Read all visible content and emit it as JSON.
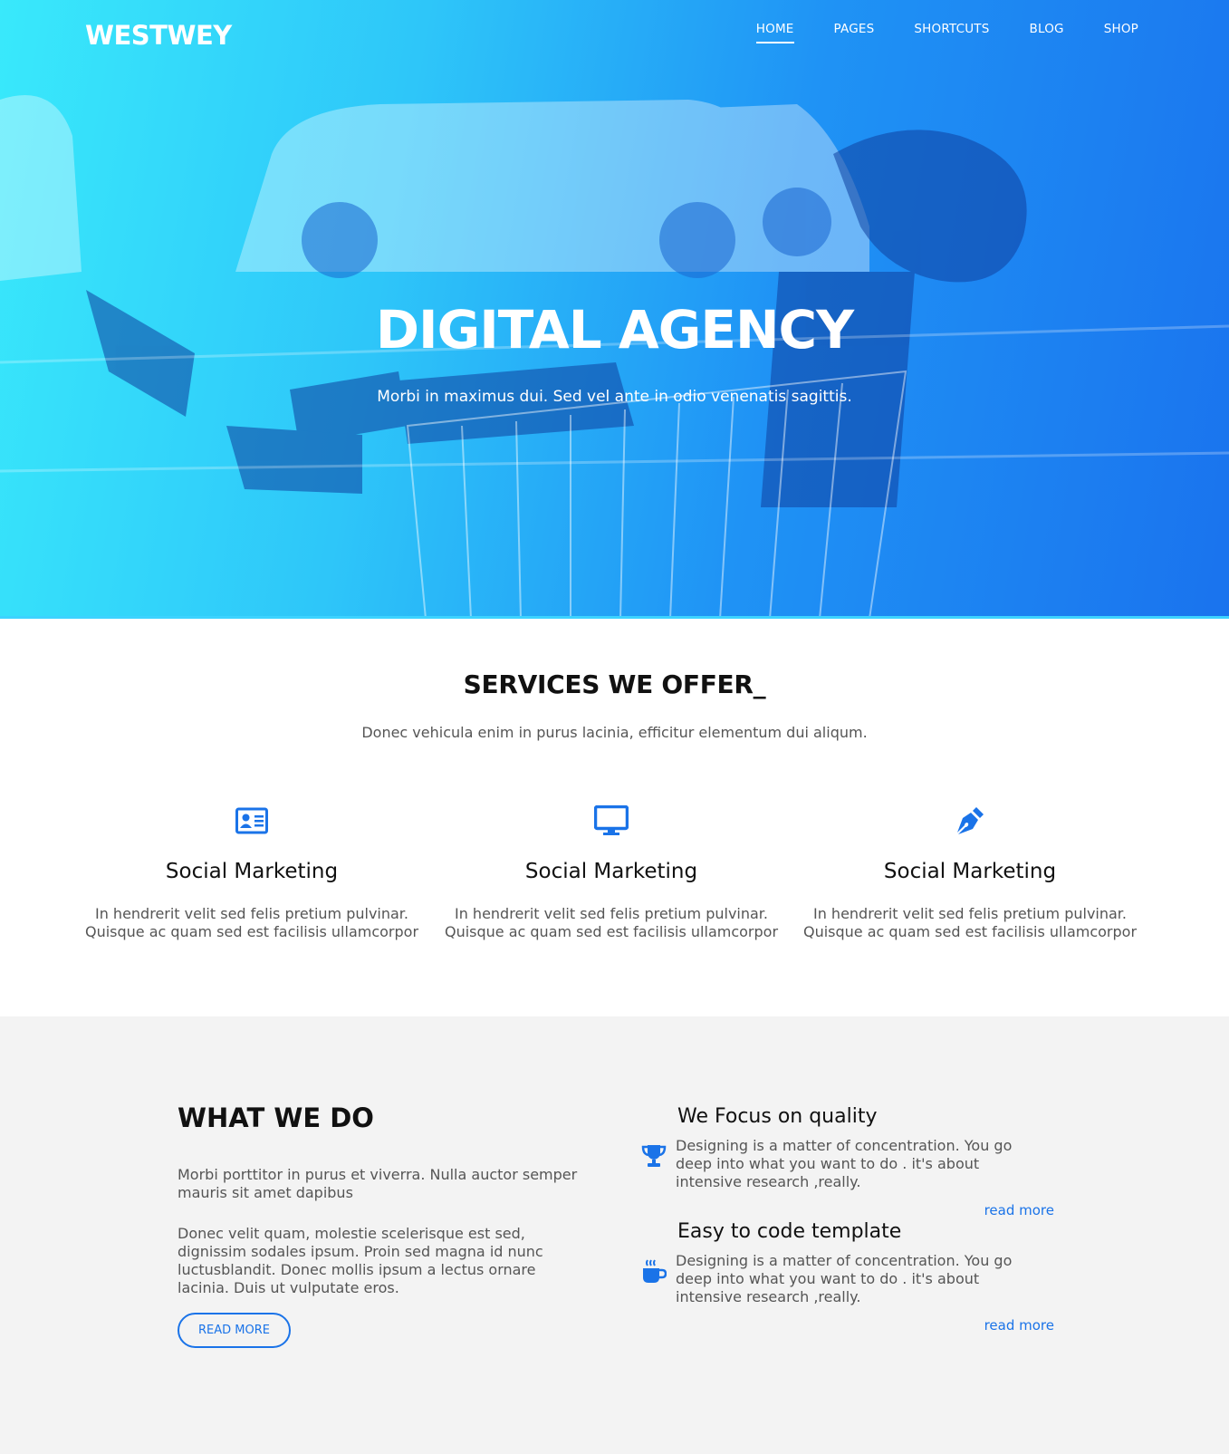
{
  "brand": {
    "logo": "WESTWEY"
  },
  "nav": {
    "items": [
      {
        "label": "HOME",
        "active": true
      },
      {
        "label": "PAGES"
      },
      {
        "label": "SHORTCUTS"
      },
      {
        "label": "BLOG"
      },
      {
        "label": "SHOP"
      }
    ]
  },
  "hero": {
    "title": "DIGITAL AGENCY",
    "subtitle": "Morbi in maximus dui. Sed vel ante in odio venenatis sagittis."
  },
  "services": {
    "title": "SERVICES WE OFFER_",
    "subtitle": "Donec vehicula enim in purus lacinia, efficitur elementum dui aliqum.",
    "items": [
      {
        "icon": "id-card-icon",
        "title": "Social Marketing",
        "text": "In hendrerit velit sed felis pretium pulvinar. Quisque ac quam sed est facilisis ullamcorpor"
      },
      {
        "icon": "monitor-icon",
        "title": "Social Marketing",
        "text": "In hendrerit velit sed felis pretium pulvinar. Quisque ac quam sed est facilisis ullamcorpor"
      },
      {
        "icon": "pen-nib-icon",
        "title": "Social Marketing",
        "text": "In hendrerit velit sed felis pretium pulvinar. Quisque ac quam sed est facilisis ullamcorpor"
      }
    ]
  },
  "what_we_do": {
    "title": "WHAT WE DO",
    "p1": "Morbi porttitor in purus et viverra. Nulla auctor semper mauris sit amet dapibus",
    "p2": "Donec velit quam, molestie scelerisque est sed, dignissim sodales ipsum. Proin sed magna id nunc luctusblandit. Donec mollis ipsum a lectus ornare lacinia. Duis ut vulputate eros.",
    "button": "READ MORE",
    "features": [
      {
        "icon": "trophy-icon",
        "title": "We Focus on quality",
        "text": "Designing is a matter of concentration. You go deep into what you want to do . it's about intensive research ,really.",
        "link": "read more"
      },
      {
        "icon": "coffee-cup-icon",
        "title": "Easy to code template",
        "text": "Designing is a matter of concentration. You go deep into what you want to do . it's about intensive research ,really.",
        "link": "read more"
      }
    ]
  },
  "colors": {
    "accent": "#1a73e8",
    "hero_start": "#39e9fb",
    "hero_end": "#1a73ee",
    "section_gray": "#f3f3f3"
  }
}
